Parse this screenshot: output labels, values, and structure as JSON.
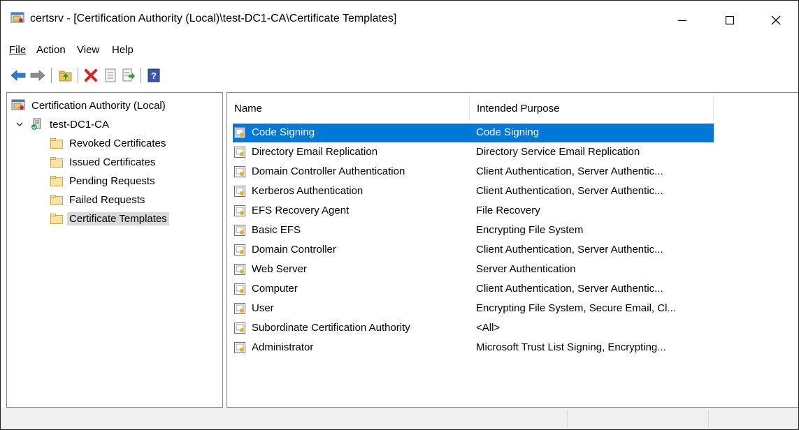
{
  "window": {
    "title": "certsrv - [Certification Authority (Local)\\test-DC1-CA\\Certificate Templates]",
    "minimize_glyph": "—",
    "maximize_glyph": "☐",
    "close_glyph": "✕"
  },
  "menu": {
    "file": "File",
    "action": "Action",
    "view": "View",
    "help": "Help"
  },
  "toolbar": {
    "icons": [
      "back-arrow-icon",
      "forward-arrow-icon",
      "up-folder-icon",
      "delete-icon",
      "properties-icon",
      "export-list-icon",
      "help-icon"
    ]
  },
  "tree": {
    "root": "Certification Authority (Local)",
    "ca": "test-DC1-CA",
    "items": [
      {
        "label": "Revoked Certificates"
      },
      {
        "label": "Issued Certificates"
      },
      {
        "label": "Pending Requests"
      },
      {
        "label": "Failed Requests"
      },
      {
        "label": "Certificate Templates"
      }
    ],
    "selected": "Certificate Templates"
  },
  "list": {
    "columns": {
      "name": "Name",
      "purpose": "Intended Purpose"
    },
    "rows": [
      {
        "name": "Code Signing",
        "purpose": "Code Signing"
      },
      {
        "name": "Directory Email Replication",
        "purpose": "Directory Service Email Replication"
      },
      {
        "name": "Domain Controller Authentication",
        "purpose": "Client Authentication, Server Authentic..."
      },
      {
        "name": "Kerberos Authentication",
        "purpose": "Client Authentication, Server Authentic..."
      },
      {
        "name": "EFS Recovery Agent",
        "purpose": "File Recovery"
      },
      {
        "name": "Basic EFS",
        "purpose": "Encrypting File System"
      },
      {
        "name": "Domain Controller",
        "purpose": "Client Authentication, Server Authentic..."
      },
      {
        "name": "Web Server",
        "purpose": "Server Authentication"
      },
      {
        "name": "Computer",
        "purpose": "Client Authentication, Server Authentic..."
      },
      {
        "name": "User",
        "purpose": "Encrypting File System, Secure Email, Cl..."
      },
      {
        "name": "Subordinate Certification Authority",
        "purpose": "<All>"
      },
      {
        "name": "Administrator",
        "purpose": "Microsoft Trust List Signing, Encrypting..."
      }
    ],
    "selected_row": "Code Signing"
  },
  "colors": {
    "selection": "#0078d7",
    "tree_selection": "#d9d9d9",
    "statusbar": "#f0f0f0"
  }
}
